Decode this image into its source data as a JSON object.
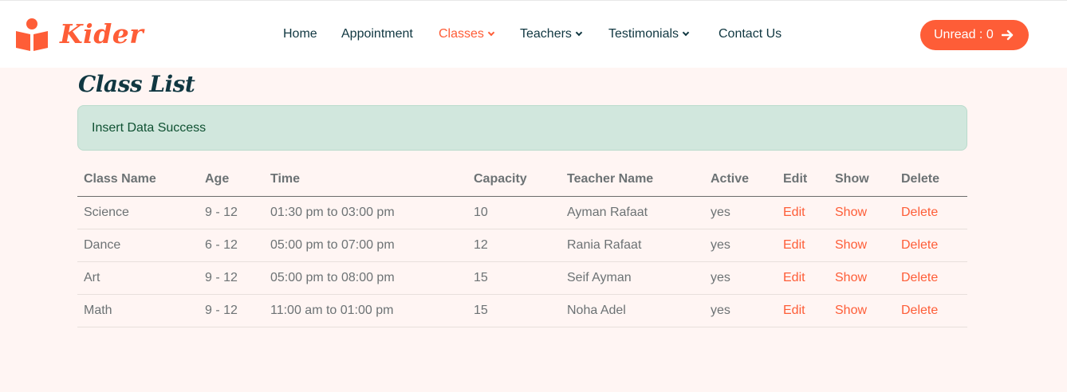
{
  "brand": {
    "name": "Kider"
  },
  "nav": {
    "items": [
      {
        "label": "Home"
      },
      {
        "label": "Appointment"
      },
      {
        "label": "Classes"
      },
      {
        "label": "Teachers"
      },
      {
        "label": "Testimonials"
      },
      {
        "label": "Contact Us"
      }
    ],
    "active": "Classes"
  },
  "unread": {
    "label": "Unread : 0"
  },
  "page": {
    "title": "Class List"
  },
  "alert": {
    "message": "Insert Data Success"
  },
  "table": {
    "headers": [
      "Class Name",
      "Age",
      "Time",
      "Capacity",
      "Teacher Name",
      "Active",
      "Edit",
      "Show",
      "Delete"
    ],
    "rows": [
      {
        "class_name": "Science",
        "age": "9 - 12",
        "time": "01:30 pm to 03:00 pm",
        "capacity": "10",
        "teacher": "Ayman Rafaat",
        "active": "yes",
        "edit": "Edit",
        "show": "Show",
        "delete": "Delete"
      },
      {
        "class_name": "Dance",
        "age": "6 - 12",
        "time": "05:00 pm to 07:00 pm",
        "capacity": "12",
        "teacher": "Rania Rafaat",
        "active": "yes",
        "edit": "Edit",
        "show": "Show",
        "delete": "Delete"
      },
      {
        "class_name": "Art",
        "age": "9 - 12",
        "time": "05:00 pm to 08:00 pm",
        "capacity": "15",
        "teacher": "Seif Ayman",
        "active": "yes",
        "edit": "Edit",
        "show": "Show",
        "delete": "Delete"
      },
      {
        "class_name": "Math",
        "age": "9 - 12",
        "time": "11:00 am to 01:00 pm",
        "capacity": "15",
        "teacher": "Noha Adel",
        "active": "yes",
        "edit": "Edit",
        "show": "Show",
        "delete": "Delete"
      }
    ]
  },
  "colors": {
    "accent": "#FE5D37",
    "dark": "#103741",
    "page_bg": "#FFF5F3",
    "alert_bg": "#D1E7DD",
    "alert_text": "#0F5132"
  },
  "icons": {
    "logo": "book-reader-icon",
    "arrow": "arrow-right-icon",
    "dropdown": "chevron-down-icon"
  }
}
